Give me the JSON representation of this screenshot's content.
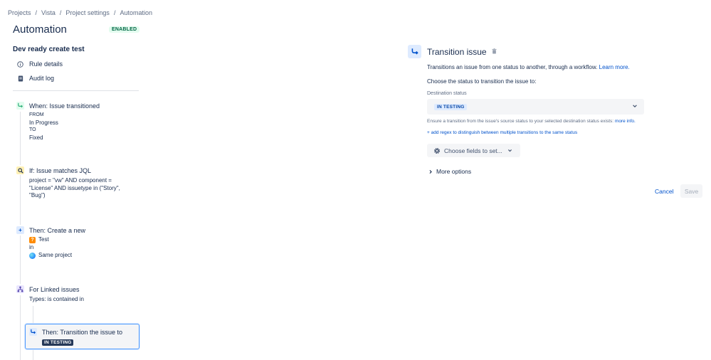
{
  "breadcrumb": [
    "Projects",
    "Vista",
    "Project settings",
    "Automation"
  ],
  "breadcrumb_sep": "/",
  "page_title": "Automation",
  "status_badge": "ENABLED",
  "rule_name": "Dev ready create test",
  "sidebar": {
    "rule_details": "Rule details",
    "audit_log": "Audit log"
  },
  "steps": {
    "trigger": {
      "title": "When: Issue transitioned",
      "from_label": "FROM",
      "from_value": "In Progress",
      "to_label": "TO",
      "to_value": "Fixed"
    },
    "condition": {
      "title": "If: Issue matches JQL",
      "line1": "project = \"vw\" AND component =",
      "line2": "\"License\" AND issuetype in (\"Story\",",
      "line3": "\"Bug\")"
    },
    "create": {
      "title": "Then: Create a new",
      "issue_type": "Test",
      "in_label": "in",
      "project": "Same project"
    },
    "branch": {
      "title": "For Linked issues",
      "types": "Types: is contained in"
    },
    "transition": {
      "title": "Then: Transition the issue to",
      "status": "IN TESTING"
    }
  },
  "panel": {
    "title": "Transition issue",
    "description": "Transitions an issue from one status to another, through a workflow.",
    "learn_more": "Learn more.",
    "choose_text": "Choose the status to transition the issue to:",
    "destination_label": "Destination status",
    "destination_value": "IN TESTING",
    "ensure_text": "Ensure a transition from the issue's source status to your selected destination status exists:",
    "more_info": "more info.",
    "regex_link": "+ add regex to distinguish between multiple transitions to the same status",
    "choose_fields": "Choose fields to set...",
    "more_options": "More options",
    "cancel": "Cancel",
    "save": "Save"
  },
  "colors": {
    "link": "#0052cc",
    "enabled_badge_bg": "#e3fcef",
    "enabled_badge_text": "#006644",
    "trigger_icon": "#36b37e",
    "condition_icon_bg": "#fff0b3",
    "action_icon_bg": "#deebff",
    "branch_icon_bg": "#eae6ff",
    "selected_border": "#4c9aff"
  },
  "icons": {
    "rule_details": "info-icon",
    "audit_log": "document-icon",
    "trigger": "transition-icon",
    "condition": "search-icon",
    "create": "plus-icon",
    "branch": "branch-icon",
    "transition": "transition-icon",
    "trash": "trash-icon",
    "settings": "gear-icon",
    "expand": "chevron-right-icon",
    "dropdown": "chevron-down-icon"
  }
}
